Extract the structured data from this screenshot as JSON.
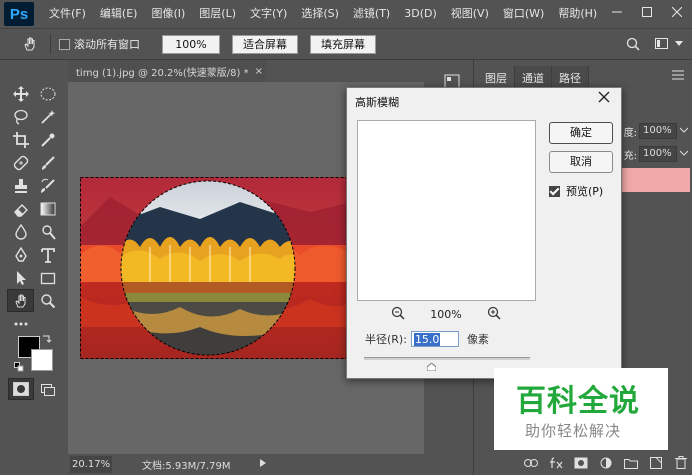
{
  "app": {
    "logo": "Ps"
  },
  "menu": [
    "文件(F)",
    "编辑(E)",
    "图像(I)",
    "图层(L)",
    "文字(Y)",
    "选择(S)",
    "滤镜(T)",
    "3D(D)",
    "视图(V)",
    "窗口(W)",
    "帮助(H)"
  ],
  "options_bar": {
    "scroll_all_windows": "滚动所有窗口",
    "zoom_btn": "100%",
    "fit_screen_btn": "适合屏幕",
    "fill_screen_btn": "填充屏幕"
  },
  "document": {
    "tab_title": "timg (1).jpg @ 20.2%(快速蒙版/8) *",
    "tab_close": "×",
    "zoom": "20.17%",
    "info": "文档:5.93M/7.79M"
  },
  "panels": {
    "tabs": [
      "图层",
      "通道",
      "路径"
    ],
    "opacity_label": "度:",
    "opacity_value": "100%",
    "fill_label": "充:",
    "fill_value": "100%"
  },
  "dialog": {
    "title": "高斯模糊",
    "ok": "确定",
    "cancel": "取消",
    "preview": "预览(P)",
    "zoom": "100%",
    "radius_label": "半径(R):",
    "radius_value": "15.0",
    "radius_unit": "像素"
  },
  "watermark": {
    "title": "百科全说",
    "subtitle": "助你轻松解决"
  },
  "colors": {
    "ps_blue": "#31a8ff",
    "quick_mask_tint": "#e8352c",
    "watermark_green": "#22a83b"
  }
}
